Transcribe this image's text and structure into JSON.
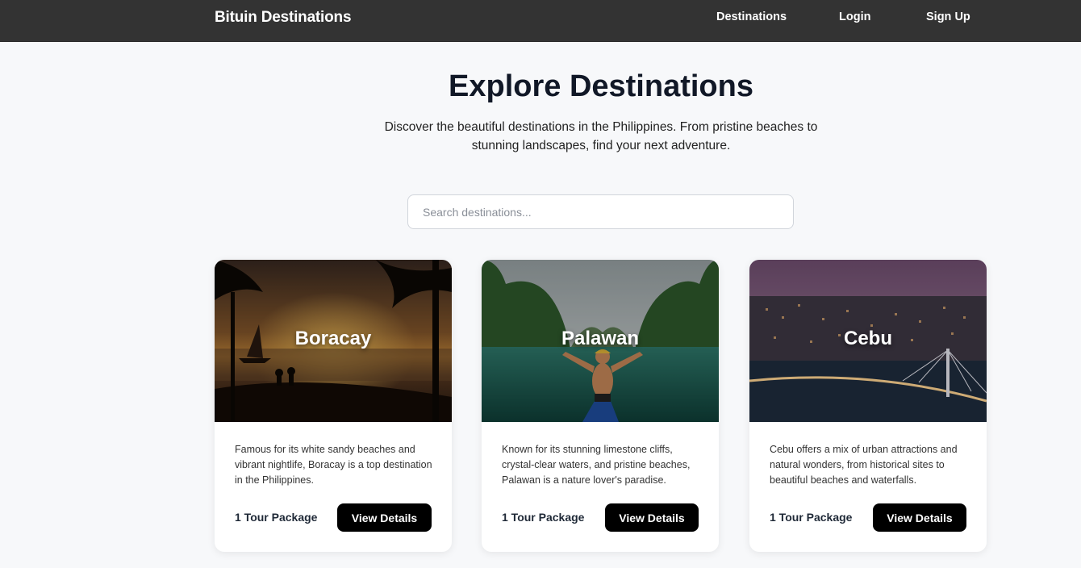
{
  "nav": {
    "brand": "Bituin Destinations",
    "links": [
      "Destinations",
      "Login",
      "Sign Up"
    ]
  },
  "hero": {
    "title": "Explore Destinations",
    "subtitle": "Discover the beautiful destinations in the Philippines. From pristine beaches to stunning landscapes, find your next adventure."
  },
  "search": {
    "placeholder": "Search destinations..."
  },
  "cards": [
    {
      "title": "Boracay",
      "description": "Famous for its white sandy beaches and vibrant nightlife, Boracay is a top destination in the Philippines.",
      "packages": "1 Tour Package",
      "button": "View Details"
    },
    {
      "title": "Palawan",
      "description": "Known for its stunning limestone cliffs, crystal-clear waters, and pristine beaches, Palawan is a nature lover's paradise.",
      "packages": "1 Tour Package",
      "button": "View Details"
    },
    {
      "title": "Cebu",
      "description": "Cebu offers a mix of urban attractions and natural wonders, from historical sites to beautiful beaches and waterfalls.",
      "packages": "1 Tour Package",
      "button": "View Details"
    }
  ]
}
